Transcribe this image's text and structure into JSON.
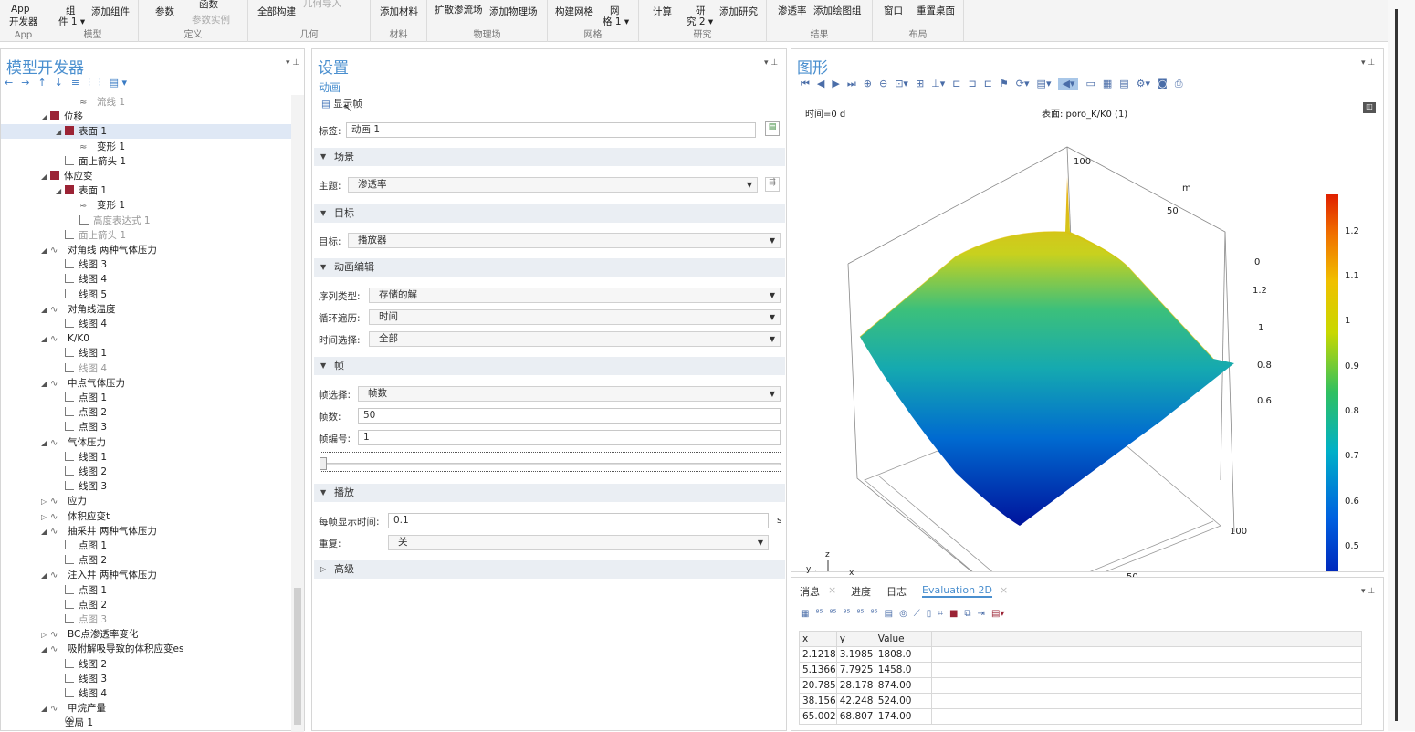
{
  "ribbon": {
    "groups": [
      {
        "label": "App",
        "buttons": [
          "App",
          "开发器"
        ]
      },
      {
        "label": "模型",
        "buttons": [
          "组",
          "件 1 ▾",
          "添加组件"
        ]
      },
      {
        "label": "定义",
        "buttons": [
          "参数",
          "函数",
          "参数实例"
        ]
      },
      {
        "label": "几何",
        "buttons": [
          "全部构建",
          "几何导入"
        ]
      },
      {
        "label": "材料",
        "buttons": [
          "添加材料"
        ]
      },
      {
        "label": "物理场",
        "buttons": [
          "扩散渗流场",
          "添加物理场"
        ]
      },
      {
        "label": "网格",
        "buttons": [
          "构建网格",
          "网",
          "格 1 ▾"
        ]
      },
      {
        "label": "研究",
        "buttons": [
          "计算",
          "研",
          "究 2 ▾",
          "添加研究"
        ]
      },
      {
        "label": "结果",
        "buttons": [
          "渗透率",
          "添加绘图组"
        ]
      },
      {
        "label": "布局",
        "buttons": [
          "窗口",
          "重置桌面"
        ]
      }
    ]
  },
  "left_panel": {
    "title": "模型开发器",
    "toolbar": [
      "←",
      "→",
      "↑",
      "↓",
      "≡",
      "⫶",
      "⫶",
      "▤ ▾"
    ],
    "tree": [
      {
        "label": "流线 1",
        "level": 4,
        "icon": "stream-icon",
        "dim": true
      },
      {
        "label": "位移",
        "level": 2,
        "icon": "plot-group-icon",
        "expanded": true
      },
      {
        "label": "表面 1",
        "level": 3,
        "icon": "plot-group-icon",
        "expanded": true,
        "selected": true
      },
      {
        "label": "变形 1",
        "level": 4,
        "icon": "deform-icon"
      },
      {
        "label": "面上箭头 1",
        "level": 3,
        "icon": "arrow-icon"
      },
      {
        "label": "体应变",
        "level": 2,
        "icon": "plot-group-icon",
        "expanded": true
      },
      {
        "label": "表面 1",
        "level": 3,
        "icon": "plot-group-icon",
        "expanded": true
      },
      {
        "label": "变形 1",
        "level": 4,
        "icon": "deform-icon"
      },
      {
        "label": "高度表达式 1",
        "level": 4,
        "icon": "height-icon",
        "dim": true
      },
      {
        "label": "面上箭头 1",
        "level": 3,
        "icon": "arrow-icon",
        "dim": true
      },
      {
        "label": "对角线 两种气体压力",
        "level": 2,
        "icon": "line-graph-icon",
        "expanded": true
      },
      {
        "label": "线图 3",
        "level": 3,
        "icon": "graph-icon"
      },
      {
        "label": "线图 4",
        "level": 3,
        "icon": "graph-icon"
      },
      {
        "label": "线图 5",
        "level": 3,
        "icon": "graph-icon"
      },
      {
        "label": "对角线温度",
        "level": 2,
        "icon": "line-graph-icon",
        "expanded": true
      },
      {
        "label": "线图 4",
        "level": 3,
        "icon": "graph-icon"
      },
      {
        "label": "K/K0",
        "level": 2,
        "icon": "line-graph-icon",
        "expanded": true
      },
      {
        "label": "线图 1",
        "level": 3,
        "icon": "graph-icon"
      },
      {
        "label": "线图 4",
        "level": 3,
        "icon": "graph-icon",
        "dim": true
      },
      {
        "label": "中点气体压力",
        "level": 2,
        "icon": "line-graph-icon",
        "expanded": true
      },
      {
        "label": "点图 1",
        "level": 3,
        "icon": "graph-icon"
      },
      {
        "label": "点图 2",
        "level": 3,
        "icon": "graph-icon"
      },
      {
        "label": "点图 3",
        "level": 3,
        "icon": "graph-icon"
      },
      {
        "label": "气体压力",
        "level": 2,
        "icon": "line-graph-icon",
        "expanded": true
      },
      {
        "label": "线图 1",
        "level": 3,
        "icon": "graph-icon"
      },
      {
        "label": "线图 2",
        "level": 3,
        "icon": "graph-icon"
      },
      {
        "label": "线图 3",
        "level": 3,
        "icon": "graph-icon"
      },
      {
        "label": "应力",
        "level": 2,
        "icon": "line-graph-icon",
        "expanded": false
      },
      {
        "label": "体积应变t",
        "level": 2,
        "icon": "line-graph-icon",
        "expanded": false
      },
      {
        "label": "抽采井 两种气体压力",
        "level": 2,
        "icon": "line-graph-icon",
        "expanded": true
      },
      {
        "label": "点图 1",
        "level": 3,
        "icon": "graph-icon"
      },
      {
        "label": "点图 2",
        "level": 3,
        "icon": "graph-icon"
      },
      {
        "label": "注入井 两种气体压力",
        "level": 2,
        "icon": "line-graph-icon",
        "expanded": true
      },
      {
        "label": "点图 1",
        "level": 3,
        "icon": "graph-icon"
      },
      {
        "label": "点图 2",
        "level": 3,
        "icon": "graph-icon"
      },
      {
        "label": "点图 3",
        "level": 3,
        "icon": "graph-icon",
        "dim": true
      },
      {
        "label": "BC点渗透率变化",
        "level": 2,
        "icon": "line-graph-icon",
        "expanded": false
      },
      {
        "label": "吸附解吸导致的体积应变es",
        "level": 2,
        "icon": "line-graph-icon",
        "expanded": true
      },
      {
        "label": "线图 2",
        "level": 3,
        "icon": "graph-icon"
      },
      {
        "label": "线图 3",
        "level": 3,
        "icon": "graph-icon"
      },
      {
        "label": "线图 4",
        "level": 3,
        "icon": "graph-icon"
      },
      {
        "label": "甲烷产量",
        "level": 2,
        "icon": "line-graph-icon",
        "expanded": true
      },
      {
        "label": "全局 1",
        "level": 3,
        "icon": "global-icon"
      }
    ]
  },
  "settings": {
    "title": "设置",
    "subtitle": "动画",
    "show_frame_btn": "显示帧",
    "label_label": "标签:",
    "label_value": "动画 1",
    "section_scene": "场景",
    "subject_label": "主题:",
    "subject_value": "渗透率",
    "section_target": "目标",
    "target_label": "目标:",
    "target_value": "播放器",
    "section_anim_edit": "动画编辑",
    "seq_type_label": "序列类型:",
    "seq_type_value": "存储的解",
    "loop_label": "循环遍历:",
    "loop_value": "时间",
    "time_sel_label": "时间选择:",
    "time_sel_value": "全部",
    "section_frames": "帧",
    "frame_sel_label": "帧选择:",
    "frame_sel_value": "帧数",
    "frame_count_label": "帧数:",
    "frame_count_value": "50",
    "frame_num_label": "帧编号:",
    "frame_num_value": "1",
    "section_playback": "播放",
    "display_time_label": "每帧显示时间:",
    "display_time_value": "0.1",
    "display_time_unit": "s",
    "repeat_label": "重复:",
    "repeat_value": "关",
    "section_advanced": "高级"
  },
  "graphics": {
    "title": "图形",
    "time_label": "时间=0 d",
    "surface_label": "表面: poro_K/K0 (1)",
    "axis_unit": "m",
    "tick_top_100": "100",
    "tick_50_top": "50",
    "tick_100_bottom": "100",
    "tick_50_bottom": "50",
    "z_ticks": [
      "0",
      "1.2",
      "1",
      "0.8",
      "0.6"
    ],
    "colorbar_ticks": [
      "1.2",
      "1.1",
      "1",
      "0.9",
      "0.8",
      "0.7",
      "0.6",
      "0.5"
    ],
    "triad": [
      "z",
      "y",
      "x"
    ]
  },
  "bottom_panel": {
    "tabs": [
      "消息",
      "进度",
      "日志",
      "Evaluation 2D"
    ],
    "table": {
      "headers": [
        "x",
        "y",
        "Value"
      ],
      "rows": [
        [
          "2.1218",
          "3.1985",
          "1808.0"
        ],
        [
          "5.1366",
          "7.7925",
          "1458.0"
        ],
        [
          "20.785",
          "28.178",
          "874.00"
        ],
        [
          "38.156",
          "42.248",
          "524.00"
        ],
        [
          "65.002",
          "68.807",
          "174.00"
        ]
      ]
    }
  }
}
